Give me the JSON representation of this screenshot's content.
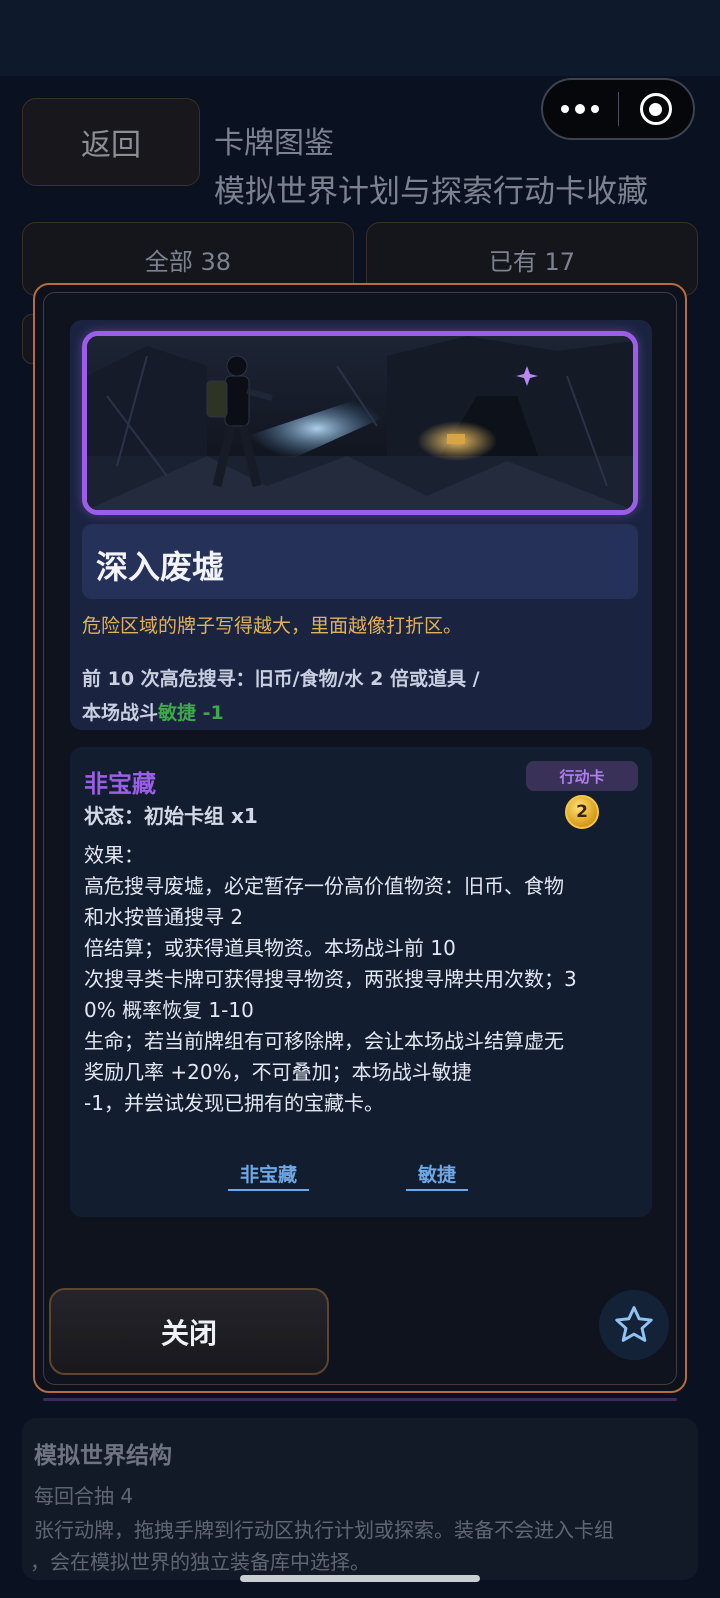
{
  "header": {
    "back_label": "返回",
    "title": "卡牌图鉴",
    "subtitle": "模拟世界计划与探索行动卡收藏"
  },
  "capsule": {
    "more_icon": "more-dots-icon",
    "close_icon": "target-close-icon"
  },
  "filters": {
    "all_label": "全部 38",
    "owned_label": "已有 17"
  },
  "section": {
    "title": "模拟世界结构",
    "line1": "每回合抽 4",
    "line2": "张行动牌，拖拽手牌到行动区执行计划或探索。装备不会进入卡组",
    "line3": "，会在模拟世界的独立装备库中选择。"
  },
  "card": {
    "name": "深入废墟",
    "flavor": "危险区域的牌子写得越大，里面越像打折区。",
    "summary_line1": "前 10 次高危搜寻：旧币/食物/水 2 倍或道具 /",
    "summary_line2_prefix": "本场战斗",
    "summary_line2_stat": "敏捷 -1",
    "rarity": "非宝藏",
    "status": "状态：初始卡组 x1",
    "type": "行动卡",
    "cost": "2",
    "effect": "效果：\n高危搜寻废墟，必定暂存一份高价值物资：旧币、食物\n和水按普通搜寻 2\n倍结算；或获得道具物资。本场战斗前 10\n次搜寻类卡牌可获得搜寻物资，两张搜寻牌共用次数；3\n0% 概率恢复 1-10\n生命；若当前牌组有可移除牌，会让本场战斗结算虚无\n奖励几率 +20%，不可叠加；本场战斗敏捷\n-1，并尝试发现已拥有的宝藏卡。",
    "keywords": [
      "非宝藏",
      "敏捷"
    ]
  },
  "modal": {
    "close_label": "关闭",
    "favorite_icon": "star-icon"
  },
  "colors": {
    "rarity": "#9b5ee6",
    "flavor": "#e0b15a",
    "stat": "#3fa84a",
    "keyword": "#6fa8e6",
    "modal_border": "#b56c3f"
  }
}
